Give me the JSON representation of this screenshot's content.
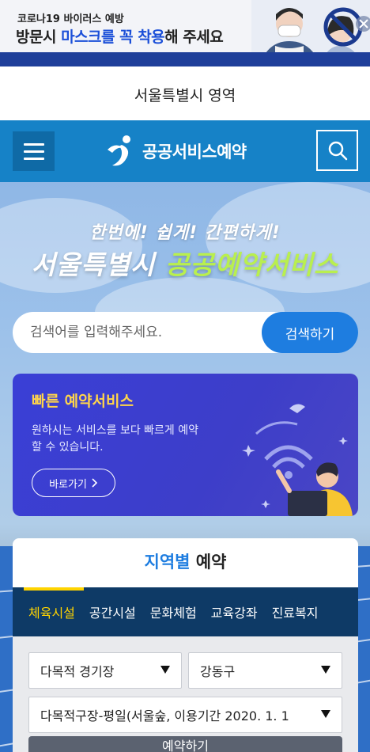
{
  "banner": {
    "line1": "코로나19 바이러스 예방",
    "line2_prefix": "방문시 ",
    "line2_highlight": "마스크를 꼭 착용",
    "line2_suffix": "해 주세요"
  },
  "seoul_area_label": "서울특별시 영역",
  "header": {
    "logo_text": "공공서비스예약"
  },
  "hero": {
    "slogan": "한번에! 쉽게! 간편하게!",
    "title_white": "서울특별시 ",
    "title_green": "공공예약서비스",
    "search": {
      "placeholder": "검색어를 입력해주세요.",
      "button_label": "검색하기"
    }
  },
  "quick_service": {
    "title": "빠른 예약서비스",
    "description": "원하시는 서비스를 보다 빠르게 예약할 수 있습니다.",
    "button_label": "바로가기"
  },
  "region": {
    "title_highlight": "지역별",
    "title_rest": " 예약",
    "tabs": [
      "체육시설",
      "공간시설",
      "문화체험",
      "교육강좌",
      "진료복지"
    ],
    "active_tab": "체육시설",
    "selects": {
      "facility_type": "다목적 경기장",
      "district": "강동구",
      "facility": "다목적구장-평일(서울숲, 이용기간 2020. 1. 1"
    },
    "submit_label": "예약하기"
  },
  "colors": {
    "header_blue": "#1682c7",
    "accent_blue": "#1e7de0",
    "yellow": "#ffd400",
    "quick_purple": "#3a3fd6",
    "tab_navy": "#0e3a66"
  }
}
